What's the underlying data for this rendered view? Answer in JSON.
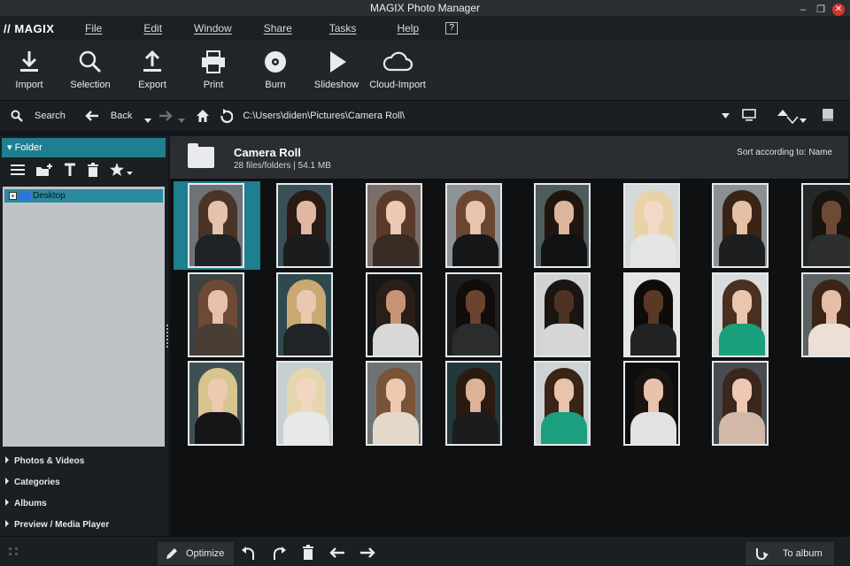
{
  "window": {
    "title": "MAGIX Photo Manager",
    "minimize": "–",
    "maximize": "❐",
    "close": "✕"
  },
  "menu": {
    "logo": "// MAGIX",
    "items": [
      "File",
      "Edit",
      "Window",
      "Share",
      "Tasks",
      "Help"
    ],
    "help_icon": "?"
  },
  "toolbar": {
    "items": [
      {
        "label": "Import",
        "icon": "download-icon"
      },
      {
        "label": "Selection",
        "icon": "magnifier-icon"
      },
      {
        "label": "Export",
        "icon": "upload-icon"
      },
      {
        "label": "Print",
        "icon": "printer-icon"
      },
      {
        "label": "Burn",
        "icon": "disc-icon"
      },
      {
        "label": "Slideshow",
        "icon": "play-icon"
      },
      {
        "label": "Cloud-Import",
        "icon": "cloud-icon"
      }
    ]
  },
  "nav": {
    "search_label": "Search",
    "back_label": "Back",
    "path": "C:\\Users\\diden\\Pictures\\Camera Roll\\"
  },
  "left": {
    "folder_header": "Folder",
    "tree_item": "Desktop",
    "tree_expand": "+",
    "sections": [
      "Photos & Videos",
      "Categories",
      "Albums",
      "Preview / Media Player"
    ]
  },
  "content": {
    "title": "Camera Roll",
    "subtitle": "28 files/folders | 54.1 MB",
    "sort": "Sort according to: Name"
  },
  "bottom": {
    "optimize": "Optimize",
    "to_album": "To album"
  },
  "colors": {
    "accent": "#1d7f8f",
    "bg": "#14171b",
    "panel": "#1b1e22"
  }
}
